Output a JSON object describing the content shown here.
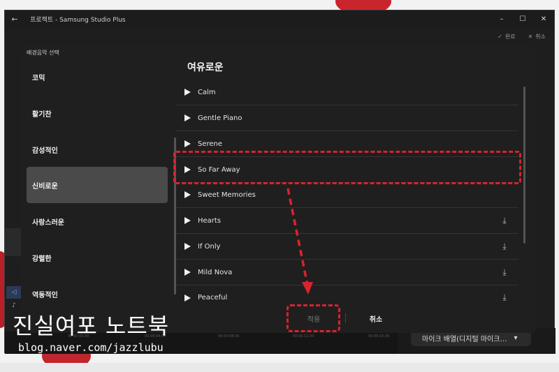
{
  "window": {
    "back_icon": "back-arrow-icon",
    "title": "프로젝트 - Samsung Studio Plus",
    "controls": [
      "–",
      "☐",
      "✕"
    ]
  },
  "topbar": {
    "done_label": "완료",
    "cancel_label": "취소"
  },
  "background": {
    "timeline_ticks": [
      "00:00:00.00",
      "00:00:04.00",
      "00:00:08.00",
      "00:00:12.00",
      "00:00:16.00"
    ],
    "mic_select_value": "마이크 배열(디지털 마이크…"
  },
  "dialog": {
    "heading": "배경음악 선택",
    "categories": [
      {
        "label": "코믹",
        "selected": false
      },
      {
        "label": "활기찬",
        "selected": false
      },
      {
        "label": "감성적인",
        "selected": false
      },
      {
        "label": "신비로운",
        "selected": true
      },
      {
        "label": "사랑스러운",
        "selected": false
      },
      {
        "label": "강렬한",
        "selected": false
      },
      {
        "label": "역동적인",
        "selected": false
      }
    ],
    "list_title": "여유로운",
    "tracks": [
      {
        "name": "Calm",
        "downloadable": false
      },
      {
        "name": "Gentle Piano",
        "downloadable": false
      },
      {
        "name": "Serene",
        "downloadable": false
      },
      {
        "name": "So Far Away",
        "downloadable": false
      },
      {
        "name": "Sweet Memories",
        "downloadable": false
      },
      {
        "name": "Hearts",
        "downloadable": true
      },
      {
        "name": "If Only",
        "downloadable": true
      },
      {
        "name": "Mild Nova",
        "downloadable": true
      },
      {
        "name": "Peaceful",
        "downloadable": true
      }
    ],
    "apply_label": "적용",
    "cancel_label": "취소"
  },
  "watermark": {
    "title": "진실여포 노트북",
    "url": "blog.naver.com/jazzlubu"
  },
  "colors": {
    "annotation": "#d9232e",
    "selected_category": "#4a4a4a",
    "dialog_bg": "#1f1f1f"
  }
}
